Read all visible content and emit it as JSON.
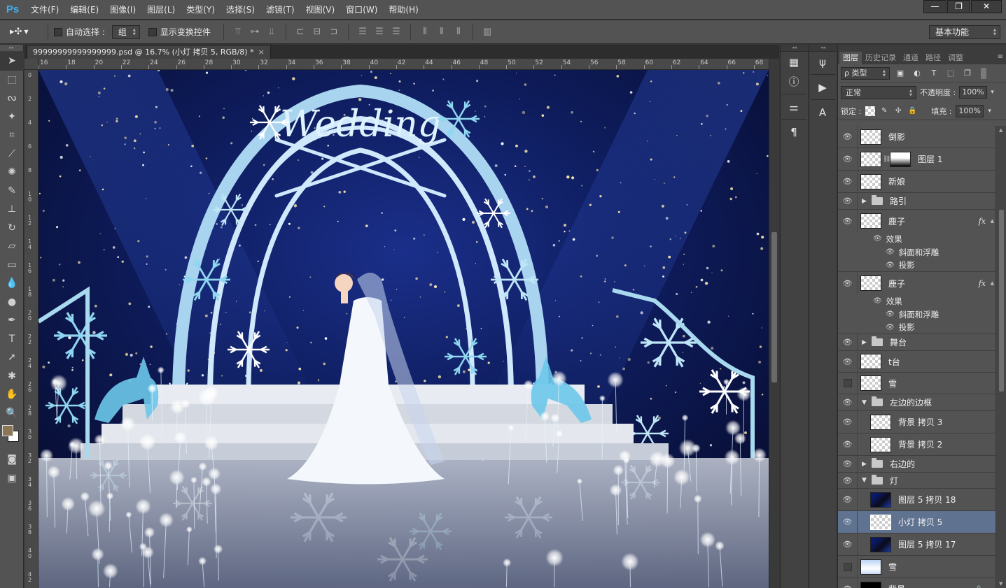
{
  "app": {
    "logo": "Ps"
  },
  "menu": [
    "文件(F)",
    "编辑(E)",
    "图像(I)",
    "图层(L)",
    "类型(Y)",
    "选择(S)",
    "滤镜(T)",
    "视图(V)",
    "窗口(W)",
    "帮助(H)"
  ],
  "window_controls": [
    "—",
    "❐",
    "✕"
  ],
  "options": {
    "auto_select_label": "自动选择 :",
    "auto_select_value": "组",
    "show_transform_label": "显示变换控件",
    "workspace": "基本功能"
  },
  "document": {
    "tab_title": "99999999999999999.psd @ 16.7% (小灯  拷贝 5, RGB/8) *",
    "close": "×",
    "ruler_top": [
      "16",
      "18",
      "20",
      "22",
      "24",
      "26",
      "28",
      "30",
      "32",
      "34",
      "36",
      "38",
      "40",
      "42",
      "44",
      "46",
      "48",
      "50",
      "52",
      "54",
      "56",
      "58",
      "60",
      "62",
      "64",
      "66",
      "68"
    ],
    "ruler_left": [
      "0",
      "2",
      "4",
      "6",
      "8",
      "10",
      "12",
      "14",
      "16",
      "18",
      "20",
      "22",
      "24",
      "26",
      "28",
      "30",
      "32",
      "34",
      "36",
      "38",
      "40",
      "42"
    ]
  },
  "canvas": {
    "sign_text": "Wedding",
    "colors": {
      "sky": "#0b1440",
      "glow": "#1e3ab0",
      "ice": "#8fd6f0",
      "floor": "#aab3c9"
    }
  },
  "layers_panel": {
    "tabs": [
      "图层",
      "历史记录",
      "通道",
      "路径",
      "调整"
    ],
    "menu_icon": "≡",
    "filter_kind": "ρ 类型",
    "blend_mode": "正常",
    "opacity_label": "不透明度 :",
    "opacity_value": "100%",
    "lock_label": "锁定 :",
    "fill_label": "填充 :",
    "fill_value": "100%",
    "fx_label": "fx",
    "layers": [
      {
        "name": "倒影",
        "kind": "layer",
        "visible": true,
        "thumb": "checker"
      },
      {
        "name": "图层 1",
        "kind": "layer-mask",
        "visible": true,
        "thumb": "checker-art"
      },
      {
        "name": "新娘",
        "kind": "layer",
        "visible": true,
        "thumb": "checker"
      },
      {
        "name": "路引",
        "kind": "group-closed",
        "visible": true
      },
      {
        "name": "鹿子",
        "kind": "layer-fx",
        "visible": true,
        "thumb": "checker",
        "effects": {
          "title": "效果",
          "items": [
            "斜面和浮雕",
            "投影"
          ]
        }
      },
      {
        "name": "鹿子",
        "kind": "layer-fx",
        "visible": true,
        "thumb": "checker",
        "effects": {
          "title": "效果",
          "items": [
            "斜面和浮雕",
            "投影"
          ]
        }
      },
      {
        "name": "舞台",
        "kind": "group-closed",
        "visible": true
      },
      {
        "name": "t台",
        "kind": "layer",
        "visible": true,
        "thumb": "checker"
      },
      {
        "name": "雪",
        "kind": "layer",
        "visible": false,
        "thumb": "checker"
      },
      {
        "name": "左边的边框",
        "kind": "group-open",
        "visible": true
      },
      {
        "name": "背景 拷贝 3",
        "kind": "layer",
        "visible": true,
        "thumb": "checker",
        "indent": 1
      },
      {
        "name": "背景 拷贝 2",
        "kind": "layer",
        "visible": true,
        "thumb": "checker",
        "indent": 1
      },
      {
        "name": "右边的",
        "kind": "group-closed",
        "visible": true
      },
      {
        "name": "灯",
        "kind": "group-open",
        "visible": true
      },
      {
        "name": "图层 5 拷贝 18",
        "kind": "layer",
        "visible": true,
        "thumb": "dark-art",
        "indent": 1
      },
      {
        "name": "小灯  拷贝 5",
        "kind": "layer",
        "visible": true,
        "thumb": "checker",
        "indent": 1,
        "selected": true
      },
      {
        "name": "图层 5 拷贝 17",
        "kind": "layer",
        "visible": true,
        "thumb": "dark-art",
        "indent": 1
      },
      {
        "name": "雪",
        "kind": "layer",
        "visible": false,
        "thumb": "snow-art"
      },
      {
        "name": "背景",
        "kind": "layer-locked",
        "visible": true,
        "thumb": "black"
      }
    ]
  }
}
